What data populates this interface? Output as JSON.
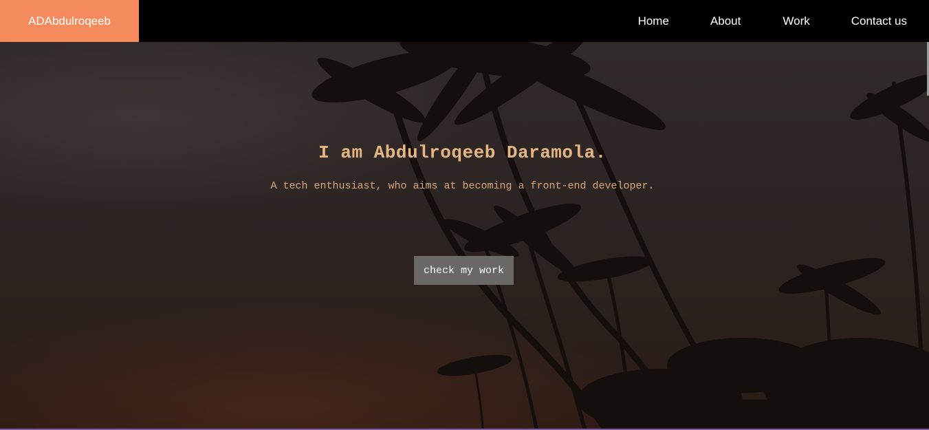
{
  "navbar": {
    "brand": "ADAbdulroqeeb",
    "links": [
      "Home",
      "About",
      "Work",
      "Contact us"
    ]
  },
  "hero": {
    "title": "I am Abdulroqeeb Daramola.",
    "subtitle": "A tech enthusiast, who aims at becoming a front-end developer.",
    "cta_label": "check my work",
    "background": "palm-trees-sunset-photo"
  },
  "colors": {
    "brand_bg": "#f58a5c",
    "navbar_bg": "#000000",
    "heading_text": "#e8b682",
    "button_bg": "#6a6866"
  }
}
